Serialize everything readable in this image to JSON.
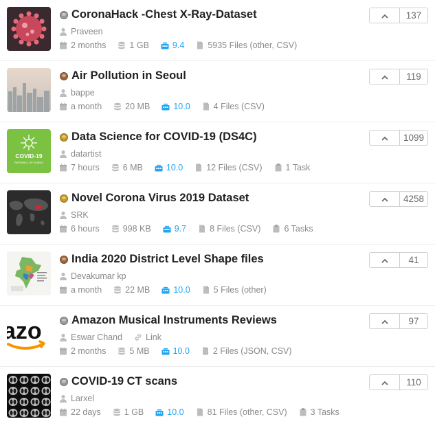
{
  "datasets": [
    {
      "title": "CoronaHack -Chest X-Ray-Dataset",
      "medal": "silver",
      "author": "Praveen",
      "link": "",
      "updated": "2 months",
      "size": "1 GB",
      "usability": "9.4",
      "files": "5935 Files (other, CSV)",
      "tasks": "",
      "votes": "137",
      "thumb": "virus-image"
    },
    {
      "title": "Air Pollution in Seoul",
      "medal": "bronze",
      "author": "bappe",
      "link": "",
      "updated": "a month",
      "size": "20 MB",
      "usability": "10.0",
      "files": "4 Files (CSV)",
      "tasks": "",
      "votes": "119",
      "thumb": "city-skyline-image"
    },
    {
      "title": "Data Science for COVID-19 (DS4C)",
      "medal": "gold",
      "author": "datartist",
      "link": "",
      "updated": "7 hours",
      "size": "6 MB",
      "usability": "10.0",
      "files": "12 Files (CSV)",
      "tasks": "1 Task",
      "votes": "1099",
      "thumb": "covid19-korea-logo",
      "thumb_text": "COVID-19",
      "thumb_sub": "REPUBLIC OF KOREA"
    },
    {
      "title": "Novel Corona Virus 2019 Dataset",
      "medal": "gold",
      "author": "SRK",
      "link": "",
      "updated": "6 hours",
      "size": "998 KB",
      "usability": "9.7",
      "files": "8 Files (CSV)",
      "tasks": "6 Tasks",
      "votes": "4258",
      "thumb": "world-map-image"
    },
    {
      "title": "India 2020 District Level Shape files",
      "medal": "bronze",
      "author": "Devakumar kp",
      "link": "",
      "updated": "a month",
      "size": "22 MB",
      "usability": "10.0",
      "files": "5 Files (other)",
      "tasks": "",
      "votes": "41",
      "thumb": "india-map-image"
    },
    {
      "title": "Amazon Musical Instruments Reviews",
      "medal": "silver",
      "author": "Eswar Chand",
      "link": "Link",
      "updated": "2 months",
      "size": "5 MB",
      "usability": "10.0",
      "files": "2 Files (JSON, CSV)",
      "tasks": "",
      "votes": "97",
      "thumb": "amazon-logo",
      "thumb_text": "azo"
    },
    {
      "title": "COVID-19 CT scans",
      "medal": "silver",
      "author": "Larxel",
      "link": "",
      "updated": "22 days",
      "size": "1 GB",
      "usability": "10.0",
      "files": "81 Files (other, CSV)",
      "tasks": "3 Tasks",
      "votes": "110",
      "thumb": "ct-scans-image"
    }
  ],
  "colors": {
    "usability": "#20a4f3",
    "meta": "#8a8a8a",
    "gold": "#c59b21",
    "silver": "#9a9a9a",
    "bronze": "#a0663a"
  }
}
